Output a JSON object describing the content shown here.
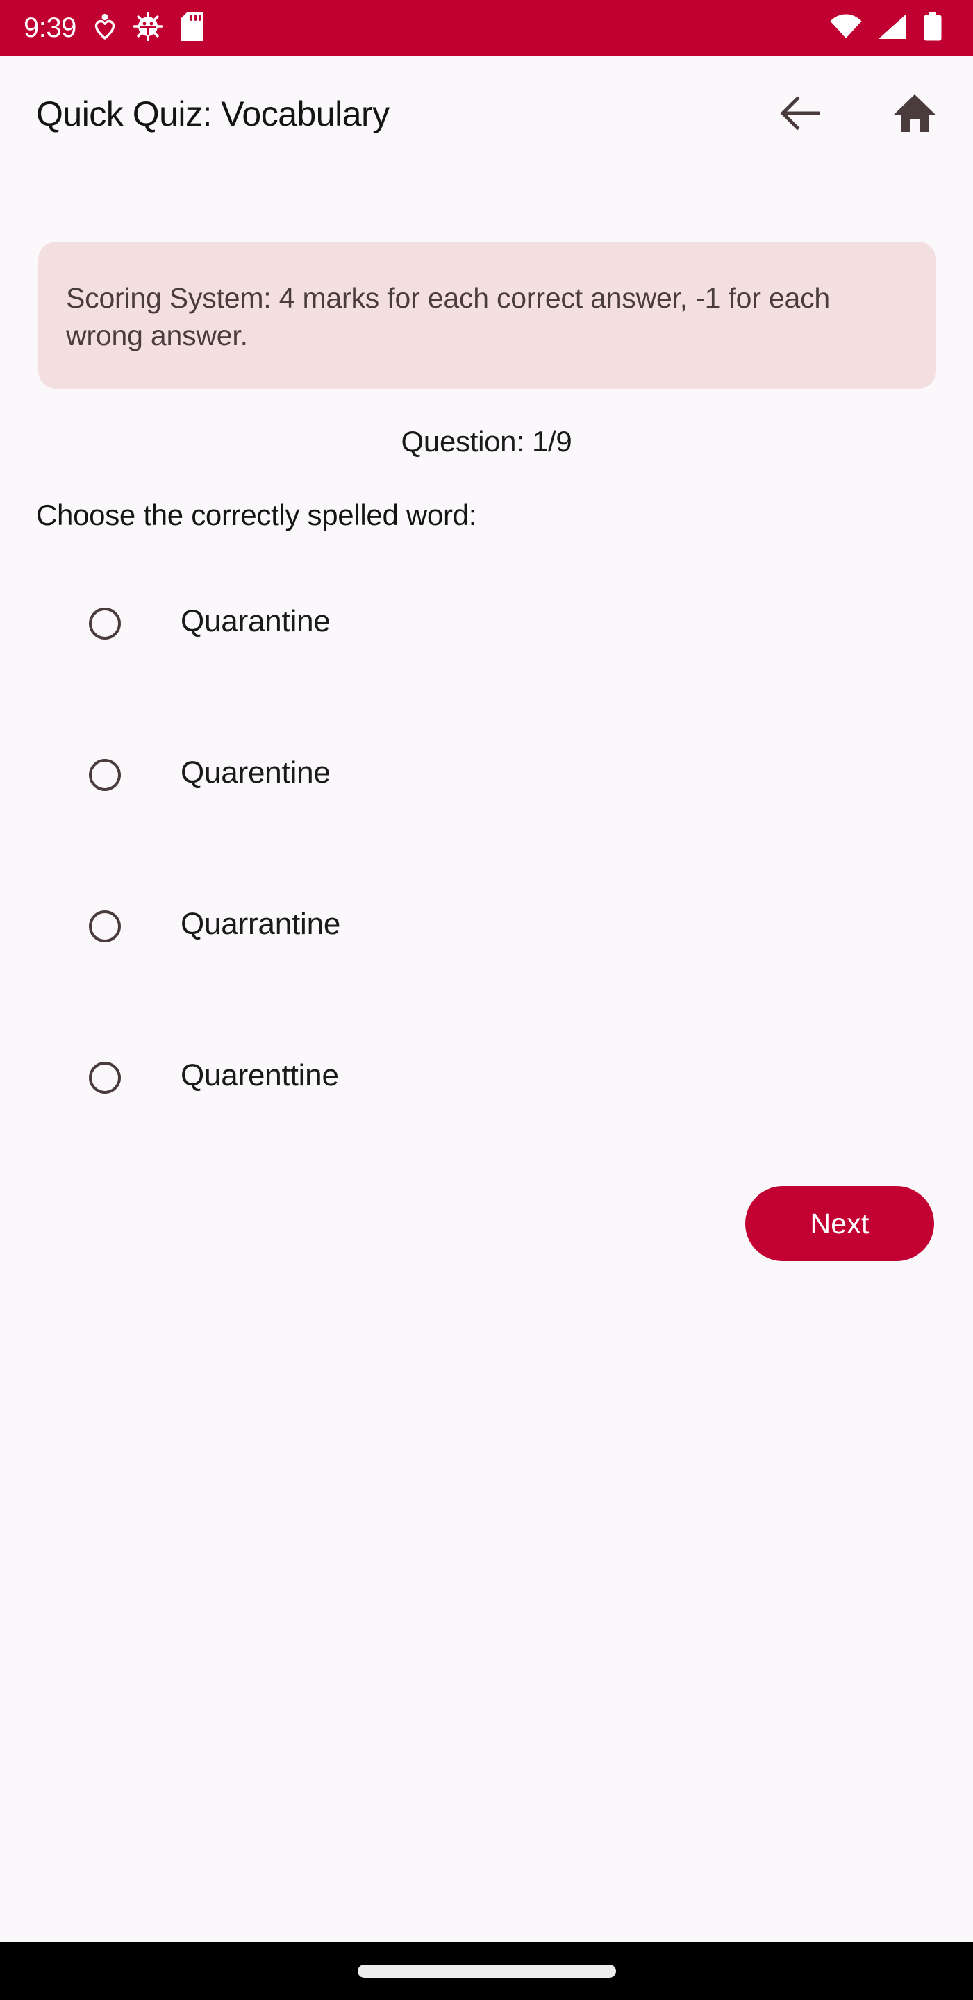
{
  "status_bar": {
    "time": "9:39",
    "background_color": "#BF0030",
    "left_icons": [
      "accessibility-heart-icon",
      "bug-debug-icon",
      "sd-card-icon"
    ],
    "right_icons": [
      "wifi-icon",
      "cellular-signal-icon",
      "battery-icon"
    ]
  },
  "app_bar": {
    "title": "Quick Quiz: Vocabulary",
    "back_label": "Back",
    "home_label": "Home",
    "icon_color": "#4A3C3C"
  },
  "banner": {
    "text": "Scoring System: 4 marks for each correct answer, -1 for each wrong answer.",
    "background_color": "#F4DFE0",
    "text_color": "#4A3C3C"
  },
  "quiz": {
    "counter": "Question: 1/9",
    "current_question": 1,
    "total_questions": 9,
    "prompt": "Choose the correctly spelled word:",
    "options": [
      {
        "label": "Quarantine",
        "selected": false
      },
      {
        "label": "Quarentine",
        "selected": false
      },
      {
        "label": "Quarrantine",
        "selected": false
      },
      {
        "label": "Quarenttine",
        "selected": false
      }
    ],
    "next_label": "Next",
    "next_color": "#C30032"
  },
  "nav_bar": {
    "background_color": "#000000",
    "handle_color": "#EDEDED"
  }
}
